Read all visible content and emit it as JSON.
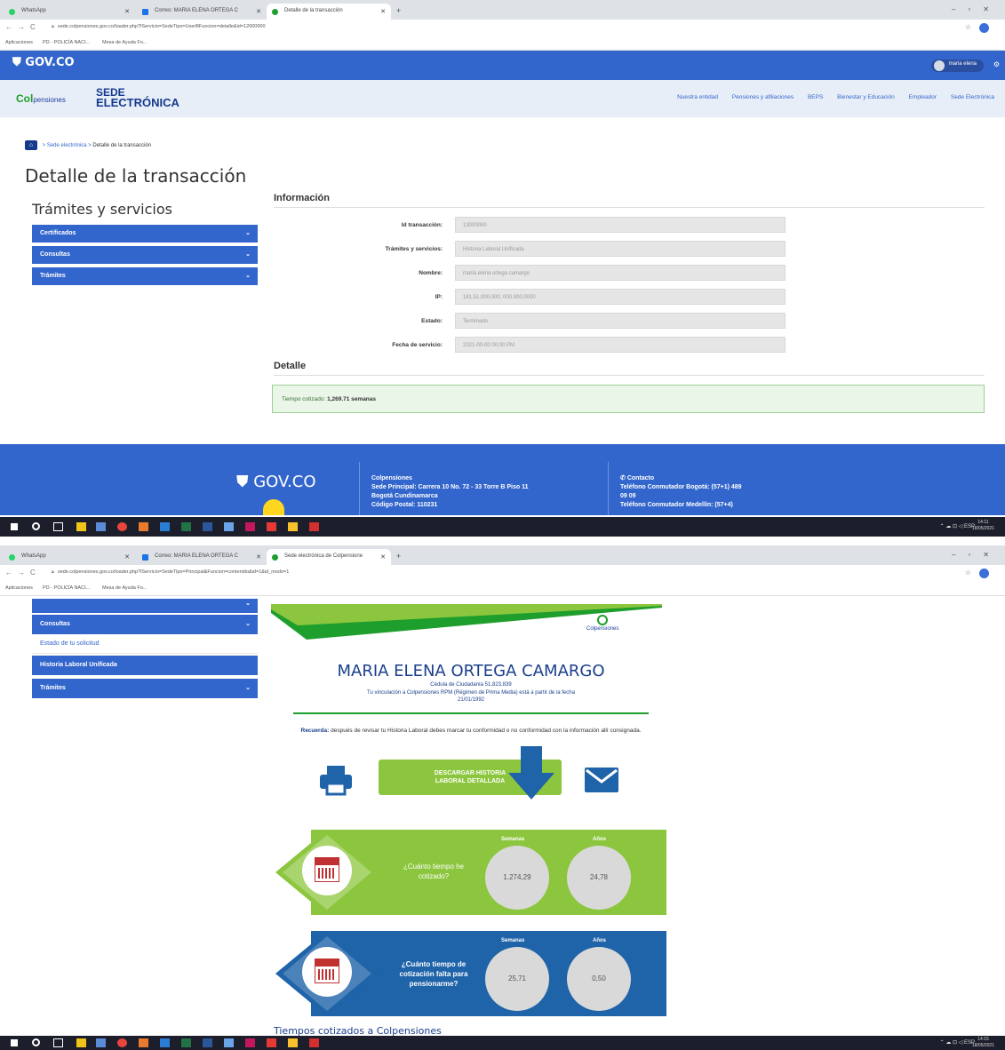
{
  "screen1": {
    "tabs": [
      {
        "title": "WhatsApp",
        "color": "#25d366"
      },
      {
        "title": "Correo: MARIA ELENA ORTEGA C",
        "color": "#1a73e8"
      },
      {
        "title": "Detalle de la transacción",
        "color": "#1e9e2c"
      }
    ],
    "url": "sede.colpensiones.gov.co/loader.php?lServicio=SedeTipo=UserBFuncion=detalle&id=12000000",
    "bookmarks": [
      "Aplicaciones",
      "PD - POLICÍA NACI...",
      "Mesa de Ayuda Fo..."
    ],
    "gov_logo": "GOV.CO",
    "user_name": "maria elena",
    "brand": {
      "colp_a": "Col",
      "colp_b": "pensiones",
      "sede_1": "SEDE",
      "sede_2": "ELECTRÓNICA"
    },
    "top_nav": [
      "Nuestra entidad",
      "Pensiones y afiliaciones",
      "BEPS",
      "Bienestar y Educación",
      "Empleador",
      "Sede Electrónica"
    ],
    "breadcrumb": {
      "link": "Sede electrónica",
      "current": "Detalle de la transacción"
    },
    "page_title": "Detalle de la transacción",
    "services_title": "Trámites y servicios",
    "menu": [
      "Certificados",
      "Consultas",
      "Trámites"
    ],
    "info_title": "Información",
    "fields": [
      {
        "label": "Id transacción:",
        "value": "13000000"
      },
      {
        "label": "Trámites y servicios:",
        "value": "Historia Laboral Unificada"
      },
      {
        "label": "Nombre:",
        "value": "maria elena ortega camargo"
      },
      {
        "label": "IP:",
        "value": "181.51.000.000, 000.000.0000"
      },
      {
        "label": "Estado:",
        "value": "Terminado"
      },
      {
        "label": "Fecha de servicio:",
        "value": "2021-00-00 00:00 PM"
      }
    ],
    "detail_title": "Detalle",
    "detail_text_prefix": "Tiempo cotizado:",
    "detail_text_value": "1,269.71 semanas",
    "footer": {
      "gov_logo": "GOV.CO",
      "org": "Colpensiones",
      "address_1": "Sede Principal: Carrera 10 No. 72 - 33 Torre B Piso 11",
      "address_2": "Bogotá Cundinamarca",
      "address_3": "Código Postal: 110231",
      "contact_title": "Contacto",
      "contact_1": "Teléfono Conmutador Bogotá: (57+1) 489",
      "contact_2": "09 09",
      "contact_3": "Teléfono Conmutador Medellín: (57+4)"
    },
    "clock_time": "14:11",
    "clock_date": "18/05/2021",
    "lang": "ESP"
  },
  "screen2": {
    "tabs": [
      {
        "title": "WhatsApp",
        "color": "#25d366"
      },
      {
        "title": "Correo: MARIA ELENA ORTEGA C",
        "color": "#1a73e8"
      },
      {
        "title": "Sede electrónica de Colpensione",
        "color": "#1e9e2c"
      }
    ],
    "url": "sede.colpensiones.gov.co/loader.php?lServicio=SedeTipo=Principal&Funcion=contenido&id=1&id_modo=1",
    "bookmarks": [
      "Aplicaciones",
      "PD - POLICÍA NACI...",
      "Mesa de Ayuda Fo..."
    ],
    "menu": {
      "consultas": "Consultas",
      "estado": "Estado de tu solicitud",
      "historia": "Historia Laboral Unificada",
      "tramites": "Trámites"
    },
    "brand_small": "Colpensiones",
    "name": "MARIA ELENA ORTEGA CAMARGO",
    "cedula": "Cédula de Ciudadanía 51,823,839",
    "vinculacion_1": "Tu vinculación a Colpensiones RPM (Régimen de Prima Media) está a partir de la fecha",
    "vinculacion_2": "21/01/1992",
    "recuerda_bold": "Recuerda:",
    "recuerda_text": "después de revisar tu Historia Laboral debes marcar tu conformidad o no conformidad con la información allí consignada.",
    "download_1": "DESCARGAR HISTORIA",
    "download_2": "LABORAL DETALLADA",
    "panel1": {
      "question": "¿Cuánto tiempo he cotizado?",
      "weeks_label": "Semanas",
      "years_label": "Años",
      "weeks": "1.274,29",
      "years": "24,78",
      "color": "#8cc63e"
    },
    "panel2": {
      "question": "¿Cuánto tiempo de cotización falta para pensionarme?",
      "weeks_label": "Semanas",
      "years_label": "Años",
      "weeks": "25,71",
      "years": "0,50",
      "color": "#1f63a8"
    },
    "tiempos_title": "Tiempos cotizados a Colpensiones",
    "clock_time": "14:15",
    "clock_date": "18/05/2021",
    "lang": "ESP"
  }
}
